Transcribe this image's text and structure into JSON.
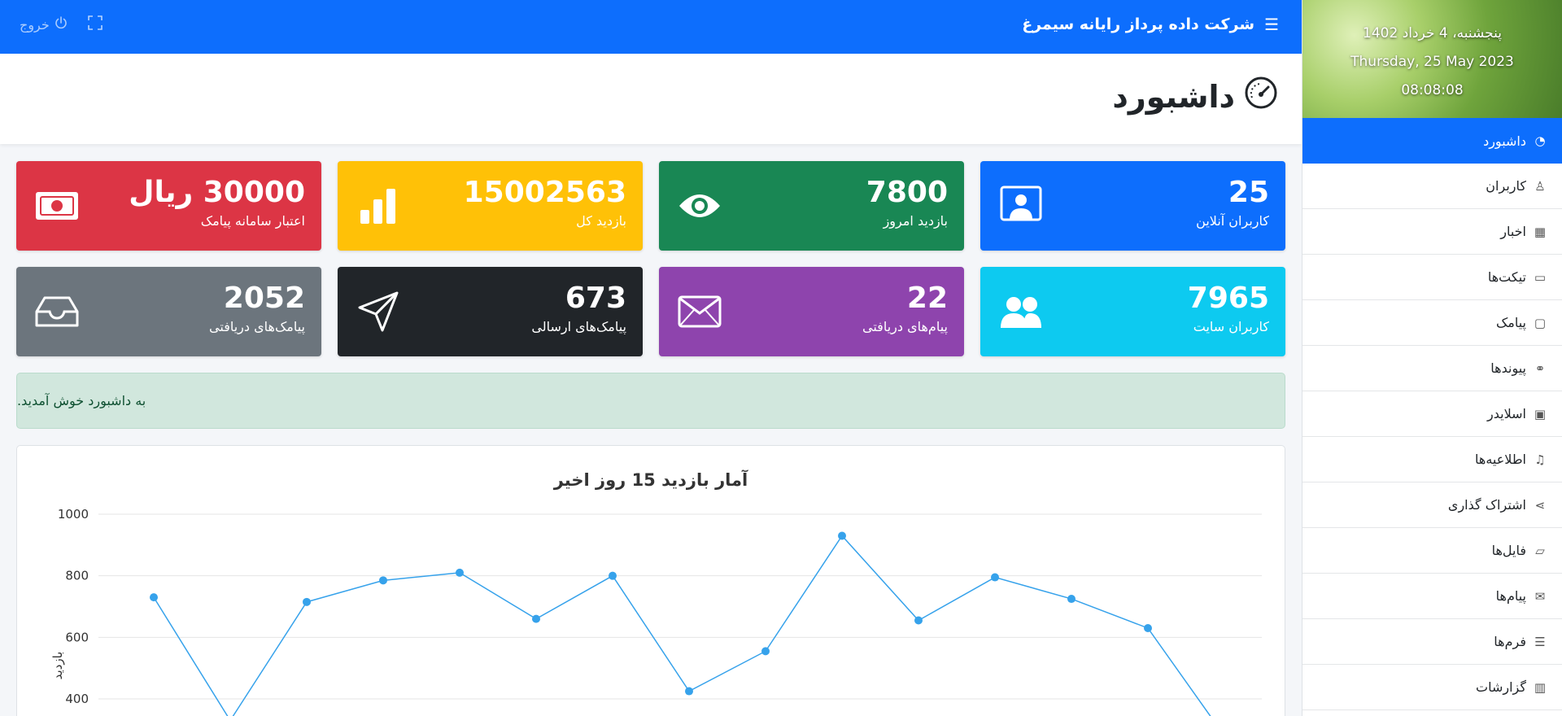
{
  "clock": {
    "persian_date": "پنجشنبه، 4 خرداد 1402",
    "gregorian_date": "Thursday, 25 May 2023",
    "time": "08:08:08"
  },
  "topbar": {
    "company": "شرکت داده پرداز رایانه سیمرغ",
    "logout": "خروج"
  },
  "page": {
    "title": "داشبورد"
  },
  "sidebar": {
    "items": [
      {
        "label": "داشبورد",
        "icon": "dashboard-icon",
        "active": true
      },
      {
        "label": "کاربران",
        "icon": "user-icon"
      },
      {
        "label": "اخبار",
        "icon": "newspaper-icon"
      },
      {
        "label": "تیکت‌ها",
        "icon": "window-icon"
      },
      {
        "label": "پیامک",
        "icon": "chat-icon"
      },
      {
        "label": "پیوندها",
        "icon": "link-icon"
      },
      {
        "label": "اسلایدر",
        "icon": "image-icon"
      },
      {
        "label": "اطلاعیه‌ها",
        "icon": "bell-icon"
      },
      {
        "label": "اشتراک گذاری",
        "icon": "share-icon"
      },
      {
        "label": "فایل‌ها",
        "icon": "folder-icon"
      },
      {
        "label": "پیام‌ها",
        "icon": "envelope-icon"
      },
      {
        "label": "فرم‌ها",
        "icon": "list-icon"
      },
      {
        "label": "گزارشات",
        "icon": "bar-chart-icon"
      }
    ]
  },
  "cards": [
    {
      "value": "25",
      "label": "کاربران آنلاین",
      "color": "#0d6efd",
      "icon": "person-video-icon"
    },
    {
      "value": "7800",
      "label": "بازدید امروز",
      "color": "#198754",
      "icon": "eye-icon"
    },
    {
      "value": "15002563",
      "label": "بازدید کل",
      "color": "#ffc107",
      "icon": "bar-chart-icon"
    },
    {
      "value": "30000 ریال",
      "label": "اعتبار سامانه پیامک",
      "color": "#dc3545",
      "icon": "cash-icon"
    },
    {
      "value": "7965",
      "label": "کاربران سایت",
      "color": "#0dcaf0",
      "icon": "people-icon"
    },
    {
      "value": "22",
      "label": "پیام‌های دریافتی",
      "color": "#8e44ad",
      "icon": "envelope-icon"
    },
    {
      "value": "673",
      "label": "پیامک‌های ارسالی",
      "color": "#212529",
      "icon": "send-icon"
    },
    {
      "value": "2052",
      "label": "پیامک‌های دریافتی",
      "color": "#6c757d",
      "icon": "inbox-icon"
    }
  ],
  "alert": {
    "text": "به داشبورد خوش آمدید."
  },
  "chart_data": {
    "type": "line",
    "title": "آمار بازدید 15 روز اخیر",
    "ylabel": "بازدید",
    "ylim": [
      0,
      1000
    ],
    "yticks": [
      400,
      600,
      800,
      1000
    ],
    "values": [
      730,
      330,
      715,
      785,
      810,
      660,
      800,
      425,
      555,
      930,
      655,
      795,
      725,
      630,
      280
    ],
    "color": "#36a2eb"
  }
}
